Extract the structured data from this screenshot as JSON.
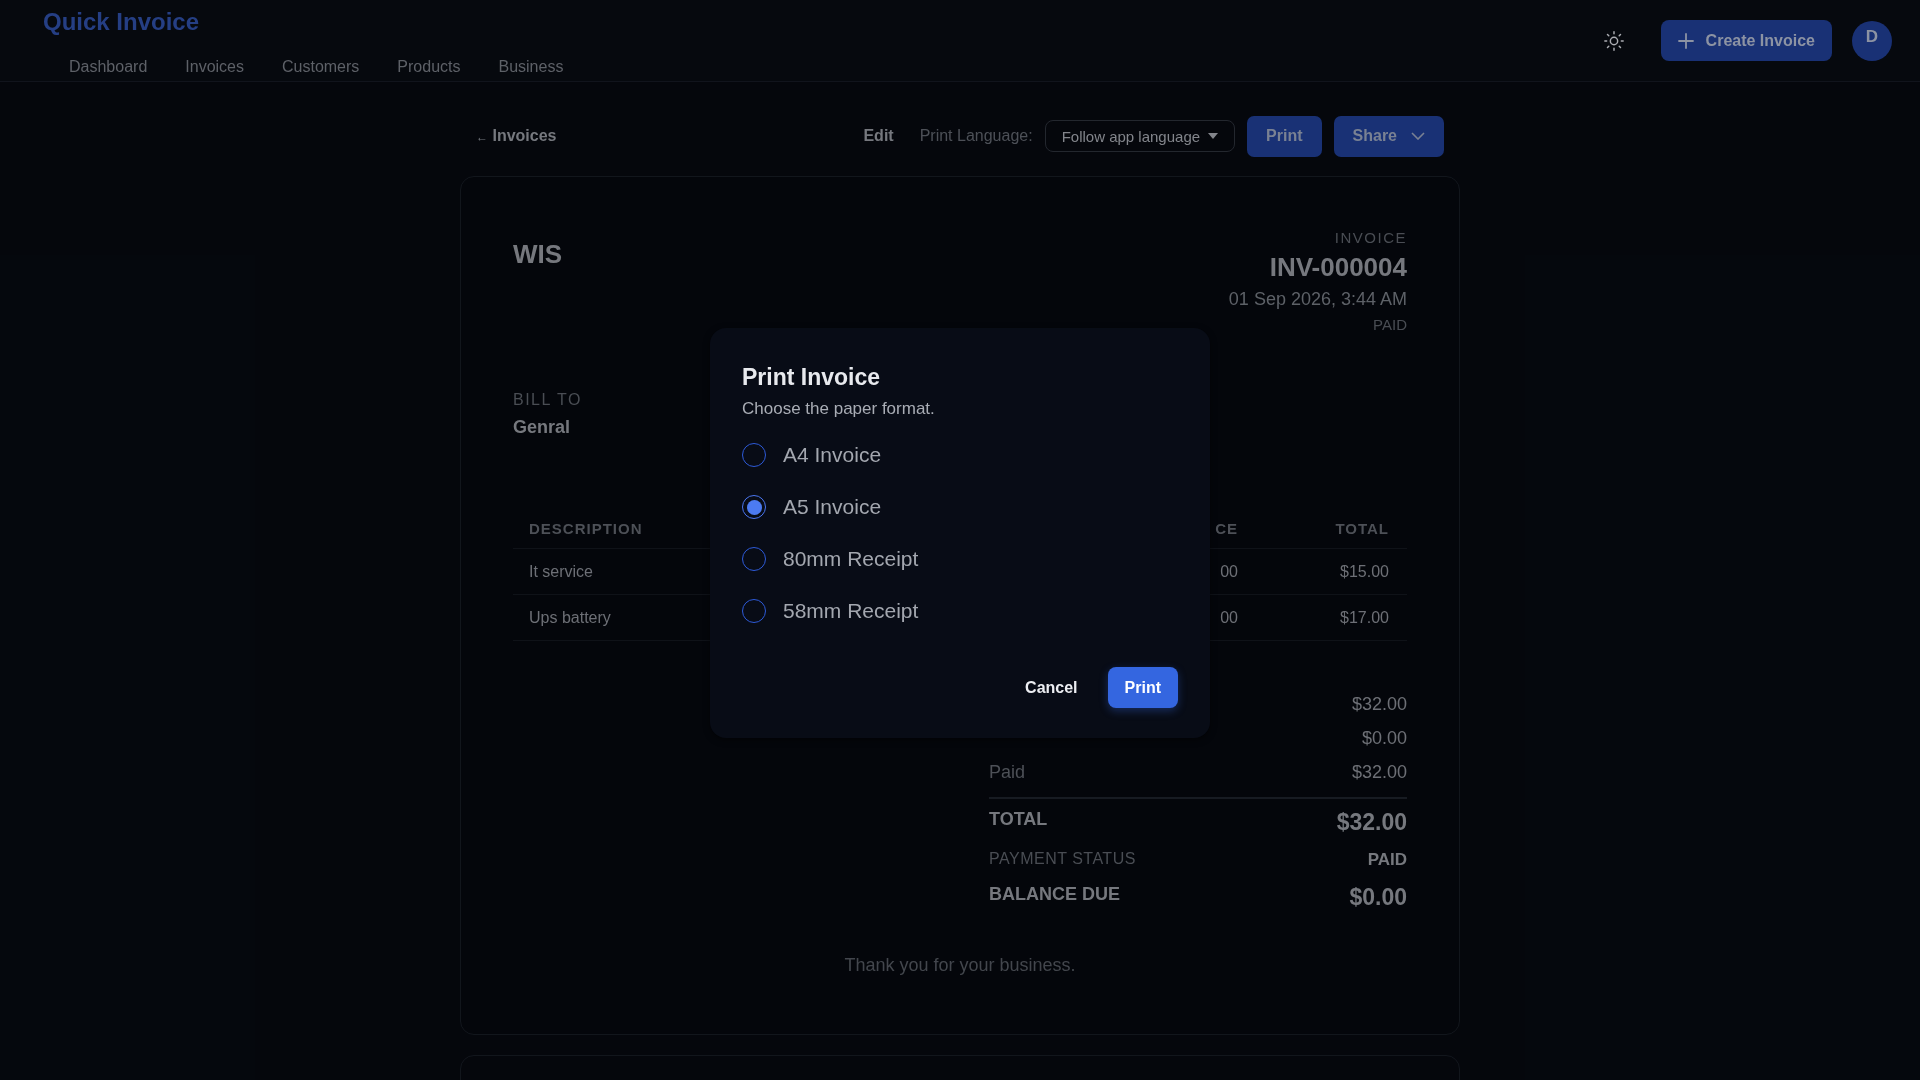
{
  "app": {
    "title": "Quick Invoice"
  },
  "nav": [
    {
      "label": "Dashboard"
    },
    {
      "label": "Invoices"
    },
    {
      "label": "Customers"
    },
    {
      "label": "Products"
    },
    {
      "label": "Business"
    }
  ],
  "header_actions": {
    "create_button": "Create Invoice",
    "avatar": "D"
  },
  "toolbar": {
    "back_arrow": "←",
    "back_label": "Invoices",
    "edit": "Edit",
    "print_language_label": "Print Language:",
    "print_language_value": "Follow app language",
    "print_button": "Print",
    "share_button": "Share"
  },
  "invoice": {
    "business": "WIS",
    "doc_label": "INVOICE",
    "number": "INV-000004",
    "date": "01 Sep 2026, 3:44 AM",
    "status": "PAID",
    "bill_to_label": "BILL TO",
    "customer": "Genral",
    "table": {
      "columns": [
        "DESCRIPTION",
        "CE",
        "TOTAL"
      ],
      "rows": [
        [
          "It service",
          "00",
          "$15.00"
        ],
        [
          "Ups battery",
          "00",
          "$17.00"
        ]
      ]
    },
    "summary": [
      {
        "value": "$32.00"
      },
      {
        "value": "$0.00"
      },
      {
        "label": "Paid",
        "value": "$32.00"
      }
    ],
    "totals": [
      {
        "label": "TOTAL",
        "value": "$32.00",
        "kind": "amount"
      },
      {
        "label": "PAYMENT STATUS",
        "value": "PAID",
        "kind": "status"
      },
      {
        "label": "BALANCE DUE",
        "value": "$0.00",
        "kind": "amount"
      }
    ],
    "note": "Thank you for your business."
  },
  "dialog": {
    "title": "Print Invoice",
    "subtitle": "Choose the paper format.",
    "options": [
      {
        "label": "A4 Invoice",
        "selected": false
      },
      {
        "label": "A5 Invoice",
        "selected": true
      },
      {
        "label": "80mm Receipt",
        "selected": false
      },
      {
        "label": "58mm Receipt",
        "selected": false
      }
    ],
    "cancel": "Cancel",
    "confirm": "Print"
  }
}
